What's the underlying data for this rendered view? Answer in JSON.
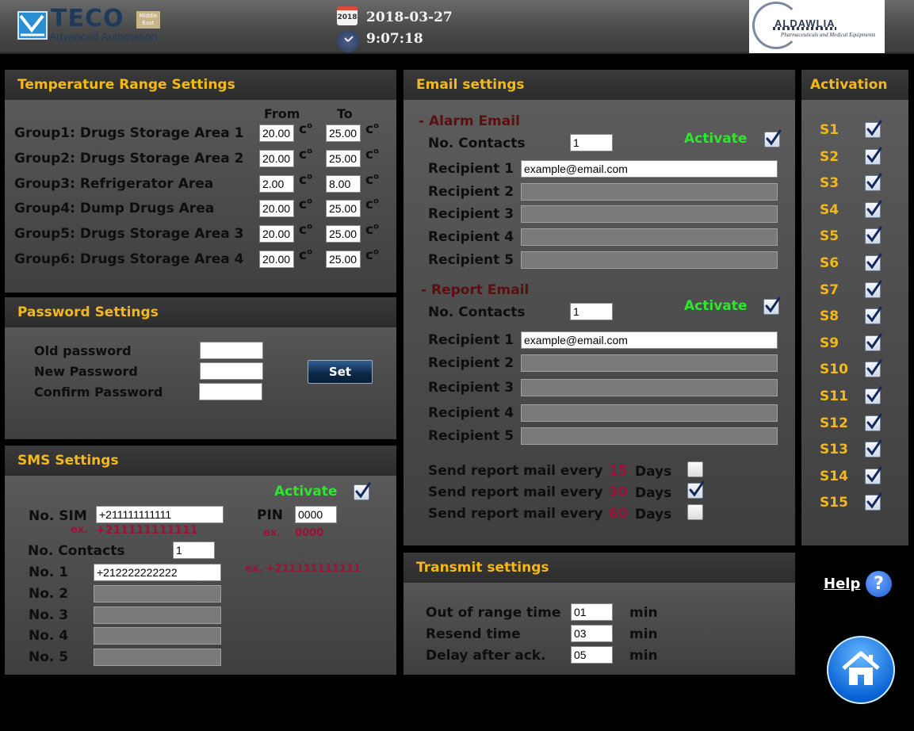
{
  "header": {
    "brand_name": "TECO",
    "brand_badge": "Middle East",
    "brand_tagline": "Advanced Automation",
    "calendar_year": "2018",
    "date": "2018-03-27",
    "time": "9:07:18",
    "partner_name": "ALDAWLIA",
    "partner_tagline": "Pharmaceuticals and Medical Equipments"
  },
  "temperature": {
    "title": "Temperature Range Settings",
    "from_label": "From",
    "to_label": "To",
    "unit": "c",
    "degree": "o",
    "groups": [
      {
        "label": "Group1: Drugs Storage Area 1",
        "from": "20.00",
        "to": "25.00"
      },
      {
        "label": "Group2: Drugs Storage Area 2",
        "from": "20.00",
        "to": "25.00"
      },
      {
        "label": "Group3: Refrigerator Area",
        "from": "2.00",
        "to": "8.00"
      },
      {
        "label": "Group4: Dump Drugs Area",
        "from": "20.00",
        "to": "25.00"
      },
      {
        "label": "Group5: Drugs Storage Area 3",
        "from": "20.00",
        "to": "25.00"
      },
      {
        "label": "Group6: Drugs Storage Area 4",
        "from": "20.00",
        "to": "25.00"
      }
    ]
  },
  "password": {
    "title": "Password Settings",
    "old_label": "Old password",
    "new_label": "New Password",
    "confirm_label": "Confirm Password",
    "set_label": "Set"
  },
  "sms": {
    "title": "SMS Settings",
    "activate_label": "Activate",
    "activate_checked": true,
    "sim_label": "No. SIM",
    "sim_value": "+211111111111",
    "ex_label": "ex.",
    "sim_example": "+211111111111",
    "pin_label": "PIN",
    "pin_value": "0000",
    "pin_example": "0000",
    "contacts_label": "No. Contacts",
    "contacts_value": "1",
    "number_example": "ex.  +211111111111",
    "numbers": [
      {
        "label": "No. 1",
        "value": "+212222222222"
      },
      {
        "label": "No. 2",
        "value": ""
      },
      {
        "label": "No. 3",
        "value": ""
      },
      {
        "label": "No. 4",
        "value": ""
      },
      {
        "label": "No. 5",
        "value": ""
      }
    ]
  },
  "email": {
    "title": "Email settings",
    "alarm": {
      "heading": "- Alarm Email",
      "contacts_label": "No. Contacts",
      "contacts_value": "1",
      "activate_label": "Activate",
      "activate_checked": true,
      "recipients": [
        {
          "label": "Recipient 1",
          "value": "example@email.com"
        },
        {
          "label": "Recipient 2",
          "value": ""
        },
        {
          "label": "Recipient 3",
          "value": ""
        },
        {
          "label": "Recipient 4",
          "value": ""
        },
        {
          "label": "Recipient 5",
          "value": ""
        }
      ]
    },
    "report": {
      "heading": "- Report Email",
      "contacts_label": "No. Contacts",
      "contacts_value": "1",
      "activate_label": "Activate",
      "activate_checked": true,
      "recipients": [
        {
          "label": "Recipient 1",
          "value": "example@email.com"
        },
        {
          "label": "Recipient 2",
          "value": ""
        },
        {
          "label": "Recipient 3",
          "value": ""
        },
        {
          "label": "Recipient 4",
          "value": ""
        },
        {
          "label": "Recipient 5",
          "value": ""
        }
      ]
    },
    "send_label": "Send report mail every",
    "days_label": "Days",
    "intervals": [
      {
        "days": "15",
        "checked": false
      },
      {
        "days": "30",
        "checked": true
      },
      {
        "days": "60",
        "checked": false
      }
    ]
  },
  "transmit": {
    "title": "Transmit settings",
    "rows": [
      {
        "label": "Out of range time",
        "value": "01",
        "unit": "min"
      },
      {
        "label": "Resend time",
        "value": "03",
        "unit": "min"
      },
      {
        "label": "Delay after ack.",
        "value": "05",
        "unit": "min"
      }
    ]
  },
  "activation": {
    "title": "Activation",
    "sensors": [
      {
        "label": "S1",
        "checked": true
      },
      {
        "label": "S2",
        "checked": true
      },
      {
        "label": "S3",
        "checked": true
      },
      {
        "label": "S4",
        "checked": true
      },
      {
        "label": "S5",
        "checked": true
      },
      {
        "label": "S6",
        "checked": true
      },
      {
        "label": "S7",
        "checked": true
      },
      {
        "label": "S8",
        "checked": true
      },
      {
        "label": "S9",
        "checked": true
      },
      {
        "label": "S10",
        "checked": true
      },
      {
        "label": "S11",
        "checked": true
      },
      {
        "label": "S12",
        "checked": true
      },
      {
        "label": "S13",
        "checked": true
      },
      {
        "label": "S14",
        "checked": true
      },
      {
        "label": "S15",
        "checked": true
      }
    ]
  },
  "footer": {
    "help_label": "Help",
    "help_icon": "question-icon",
    "home_icon": "home-icon"
  },
  "colors": {
    "title_accent": "#f3b81c",
    "activate_green": "#2ee62e",
    "example_red": "#9a1238",
    "section_dark_red": "#5a0f10"
  }
}
